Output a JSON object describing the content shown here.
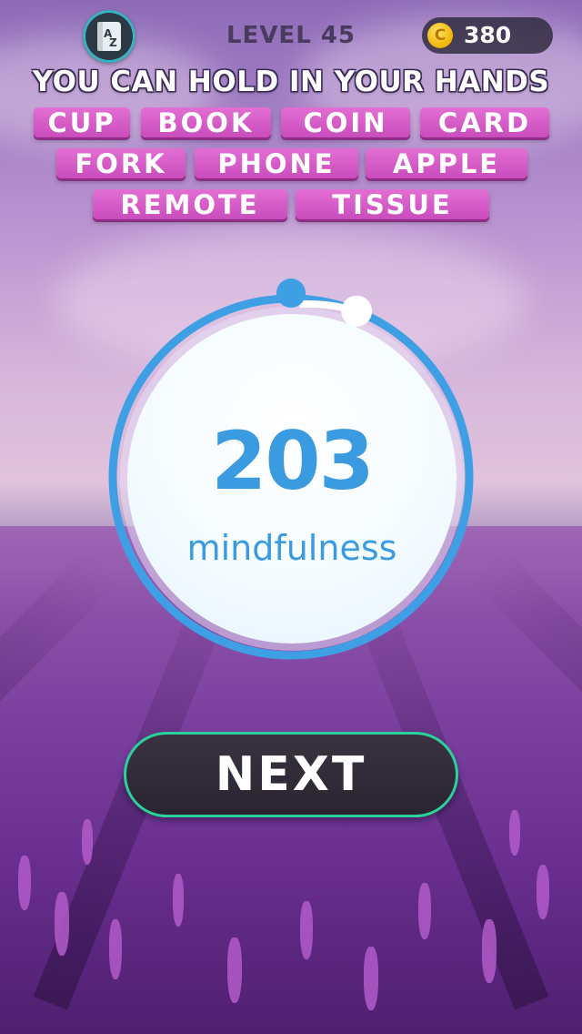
{
  "topbar": {
    "dictionary_icon": "az-dictionary-icon",
    "level_label": "LEVEL 45",
    "coin_icon": "coin-icon",
    "coin_glyph": "C",
    "coins": "380"
  },
  "puzzle": {
    "category": "YOU CAN HOLD IN YOUR HANDS",
    "words": [
      "CUP",
      "BOOK",
      "COIN",
      "CARD",
      "FORK",
      "PHONE",
      "APPLE",
      "REMOTE",
      "TISSUE"
    ]
  },
  "result": {
    "score": "203",
    "label": "mindfulness",
    "progress_fraction": 0.06
  },
  "actions": {
    "next_label": "NEXT"
  },
  "colors": {
    "accent_blue": "#3a9be0",
    "word_tile": "#d95ccb",
    "button_border": "#2bd19a"
  }
}
